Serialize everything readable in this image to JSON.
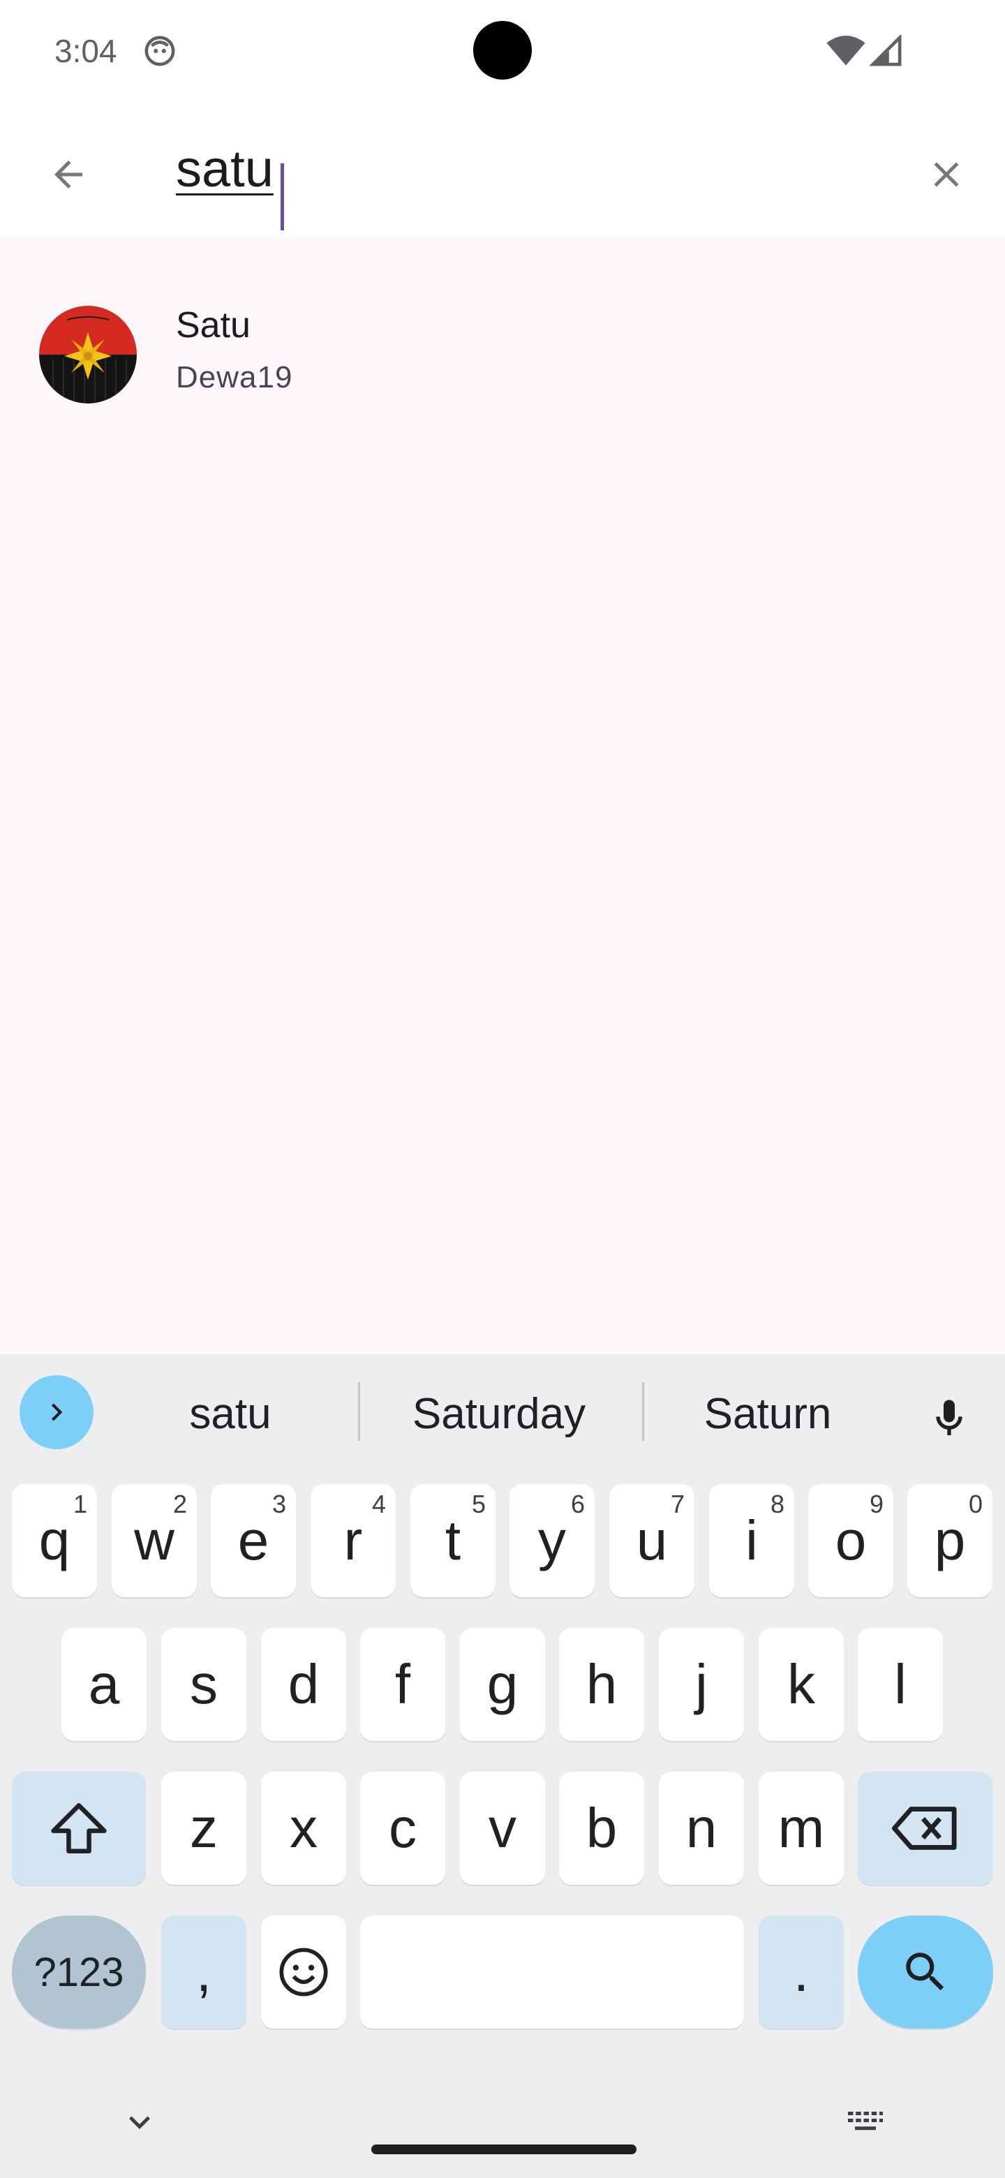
{
  "status_bar": {
    "time": "3:04"
  },
  "search": {
    "query": "satu"
  },
  "results": [
    {
      "title": "Satu",
      "subtitle": "Dewa19"
    }
  ],
  "keyboard": {
    "suggestions": [
      "satu",
      "Saturday",
      "Saturn"
    ],
    "row1": [
      {
        "key": "q",
        "hint": "1"
      },
      {
        "key": "w",
        "hint": "2"
      },
      {
        "key": "e",
        "hint": "3"
      },
      {
        "key": "r",
        "hint": "4"
      },
      {
        "key": "t",
        "hint": "5"
      },
      {
        "key": "y",
        "hint": "6"
      },
      {
        "key": "u",
        "hint": "7"
      },
      {
        "key": "i",
        "hint": "8"
      },
      {
        "key": "o",
        "hint": "9"
      },
      {
        "key": "p",
        "hint": "0"
      }
    ],
    "row2": [
      "a",
      "s",
      "d",
      "f",
      "g",
      "h",
      "j",
      "k",
      "l"
    ],
    "row3": [
      "z",
      "x",
      "c",
      "v",
      "b",
      "n",
      "m"
    ],
    "symbols_label": "?123",
    "comma_label": ",",
    "period_label": "."
  },
  "colors": {
    "accent": "#6750a4",
    "keyboard_accent": "#7dcff7",
    "background": "#fdf7fc"
  }
}
